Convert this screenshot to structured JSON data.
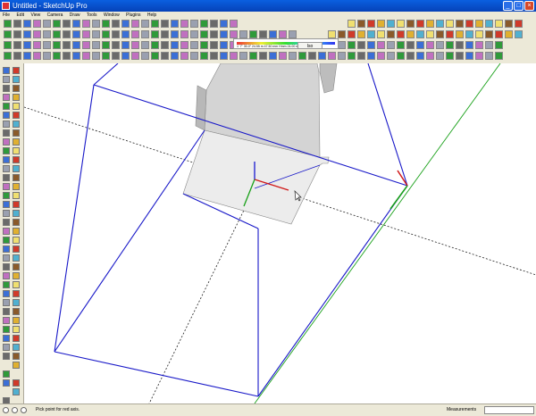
{
  "window": {
    "title": "Untitled - SketchUp Pro"
  },
  "menu": [
    "File",
    "Edit",
    "View",
    "Camera",
    "Draw",
    "Tools",
    "Window",
    "Plugins",
    "Help"
  ],
  "toolbar": {
    "camera_label": "Iso",
    "dims": {
      "values": "1' 7'' 30.0° 24.55 m  47.50 mm   Hmm   24.00 mm"
    }
  },
  "status": {
    "hint": "Pick point for red axis.",
    "measurements_label": "Measurements",
    "measurements_value": ""
  },
  "colors": {
    "titlebar": "#0a5fe0",
    "edges": "#1818c8",
    "red_axis": "#d01818",
    "green_axis": "#18a018",
    "blue_axis": "#1818d0"
  }
}
